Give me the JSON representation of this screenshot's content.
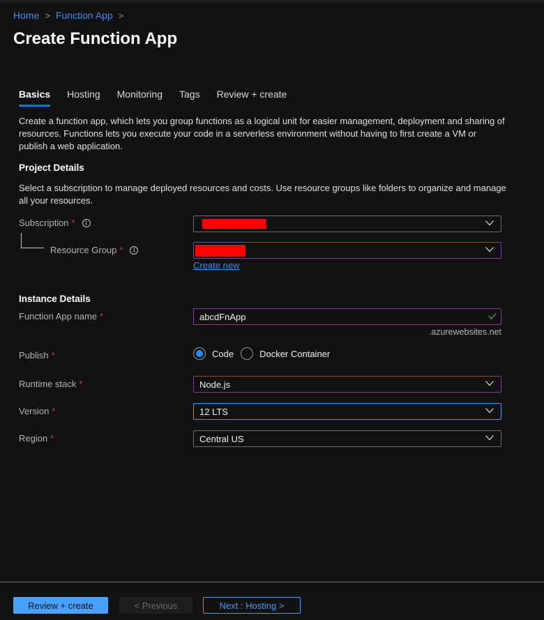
{
  "breadcrumb": [
    {
      "label": "Home"
    },
    {
      "label": "Function App"
    }
  ],
  "page_title": "Create Function App",
  "tabs": [
    {
      "label": "Basics",
      "active": true
    },
    {
      "label": "Hosting",
      "active": false
    },
    {
      "label": "Monitoring",
      "active": false
    },
    {
      "label": "Tags",
      "active": false
    },
    {
      "label": "Review + create",
      "active": false
    }
  ],
  "intro_text": "Create a function app, which lets you group functions as a logical unit for easier management, deployment and sharing of resources. Functions lets you execute your code in a serverless environment without having to first create a VM or publish a web application.",
  "project_details": {
    "heading": "Project Details",
    "description": "Select a subscription to manage deployed resources and costs. Use resource groups like folders to organize and manage all your resources.",
    "subscription": {
      "label": "Subscription",
      "required_mark": "*",
      "value": "[redacted]"
    },
    "resource_group": {
      "label": "Resource Group",
      "required_mark": "*",
      "value": "[redacted]",
      "create_new_link": "Create new"
    }
  },
  "instance_details": {
    "heading": "Instance Details",
    "function_app_name": {
      "label": "Function App name",
      "required_mark": "*",
      "value": "abcdFnApp",
      "suffix": ".azurewebsites.net",
      "valid": true
    },
    "publish": {
      "label": "Publish",
      "required_mark": "*",
      "options": [
        "Code",
        "Docker Container"
      ],
      "selected": "Code"
    },
    "runtime_stack": {
      "label": "Runtime stack",
      "required_mark": "*",
      "value": "Node.js"
    },
    "version": {
      "label": "Version",
      "required_mark": "*",
      "value": "12 LTS"
    },
    "region": {
      "label": "Region",
      "required_mark": "*",
      "value": "Central US"
    }
  },
  "footer": {
    "review_create_label": "Review + create",
    "previous_label": "< Previous",
    "next_label": "Next : Hosting >"
  },
  "colors": {
    "background": "#111111",
    "link": "#3e8fe8",
    "tab_underline": "#0f78d4",
    "required": "#e0323a",
    "invalid_border": "#8a3aa0",
    "focus_border": "#4a9ae8",
    "primary_button": "#4aa0ff",
    "radio_selected": "#1890ff",
    "valid_check": "#5a9a2a"
  }
}
